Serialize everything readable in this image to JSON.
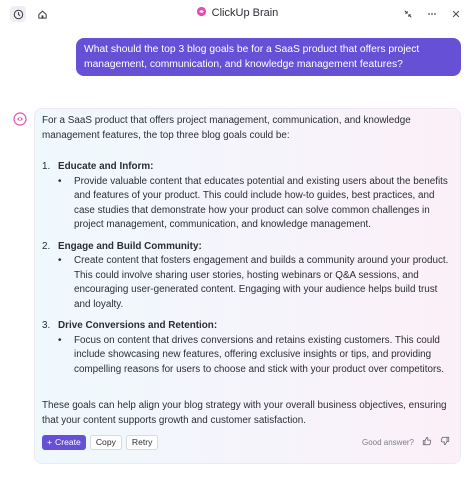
{
  "header": {
    "title": "ClickUp Brain",
    "left_icons": [
      "history-icon",
      "home-icon"
    ],
    "right_icons": [
      "collapse-icon",
      "more-icon",
      "close-icon"
    ]
  },
  "user_message": "What should the top 3 blog goals be for a SaaS product that offers project management, communication, and knowledge management features?",
  "response": {
    "intro": "For a SaaS product that offers project management, communication, and knowledge management features, the top three blog goals could be:",
    "goals": [
      {
        "num": "1.",
        "title": "Educate and Inform:",
        "body": "Provide valuable content that educates potential and existing users about the benefits and features of your product. This could include how-to guides, best practices, and case studies that demonstrate how your product can solve common challenges in project management, communication, and knowledge management."
      },
      {
        "num": "2.",
        "title": "Engage and Build Community:",
        "body": "Create content that fosters engagement and builds a community around your product. This could involve sharing user stories, hosting webinars or Q&A sessions, and encouraging user-generated content. Engaging with your audience helps build trust and loyalty."
      },
      {
        "num": "3.",
        "title": "Drive Conversions and Retention:",
        "body": "Focus on content that drives conversions and retains existing customers. This could include showcasing new features, offering exclusive insights or tips, and providing compelling reasons for users to choose and stick with your product over competitors."
      }
    ],
    "outro": "These goals can help align your blog strategy with your overall business objectives, ensuring that your content supports growth and customer satisfaction."
  },
  "actions": {
    "create": "Create",
    "copy": "Copy",
    "retry": "Retry"
  },
  "feedback": {
    "label": "Good answer?"
  },
  "colors": {
    "accent": "#6650d6",
    "brain_pink": "#e24fb1"
  }
}
